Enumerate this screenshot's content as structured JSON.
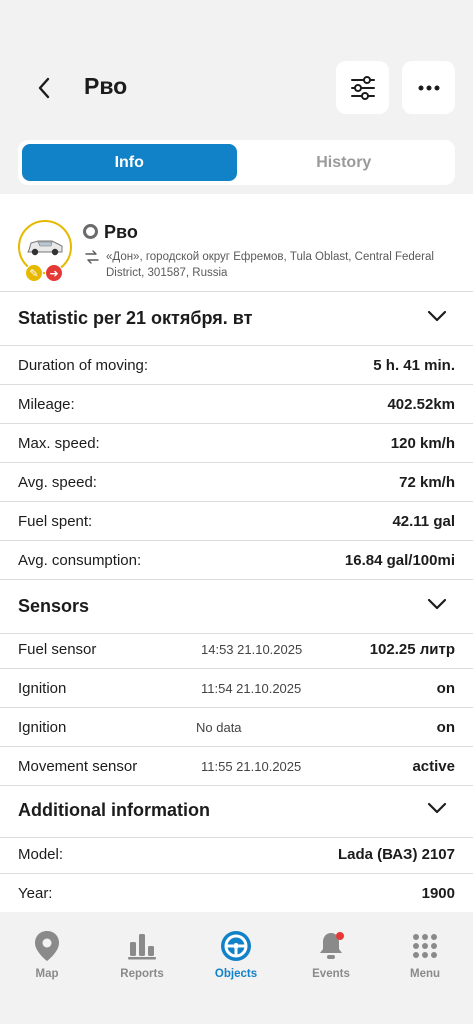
{
  "header": {
    "title": "Рво"
  },
  "tabs": {
    "info": "Info",
    "history": "History"
  },
  "object": {
    "name": "Рво",
    "address": "«Дон», городской округ Ефремов, Tula Oblast, Central Federal District, 301587, Russia"
  },
  "statistic": {
    "title": "Statistic per 21 октября. вт",
    "rows": [
      {
        "label": "Duration of moving:",
        "value": "5 h. 41 min."
      },
      {
        "label": "Mileage:",
        "value": "402.52km"
      },
      {
        "label": "Max. speed:",
        "value": "120 km/h"
      },
      {
        "label": "Avg. speed:",
        "value": "72 km/h"
      },
      {
        "label": "Fuel spent:",
        "value": "42.11 gal"
      },
      {
        "label": "Avg. consumption:",
        "value": "16.84 gal/100mi"
      }
    ]
  },
  "sensors": {
    "title": "Sensors",
    "rows": [
      {
        "label": "Fuel sensor",
        "time": "14:53 21.10.2025",
        "value": "102.25 литр"
      },
      {
        "label": "Ignition",
        "time": "11:54 21.10.2025",
        "value": "on"
      },
      {
        "label": "Ignition",
        "time": "No data",
        "value": "on"
      },
      {
        "label": "Movement sensor",
        "time": "11:55 21.10.2025",
        "value": "active"
      }
    ]
  },
  "additional": {
    "title": "Additional information",
    "rows": [
      {
        "label": "Model:",
        "value": "Lada (ВАЗ) 2107"
      },
      {
        "label": "Year:",
        "value": "1900"
      }
    ]
  },
  "nav": {
    "map": "Map",
    "reports": "Reports",
    "objects": "Objects",
    "events": "Events",
    "menu": "Menu"
  },
  "colors": {
    "accent": "#1282c8",
    "alert": "#e53935",
    "key_badge": "#e6b800"
  }
}
